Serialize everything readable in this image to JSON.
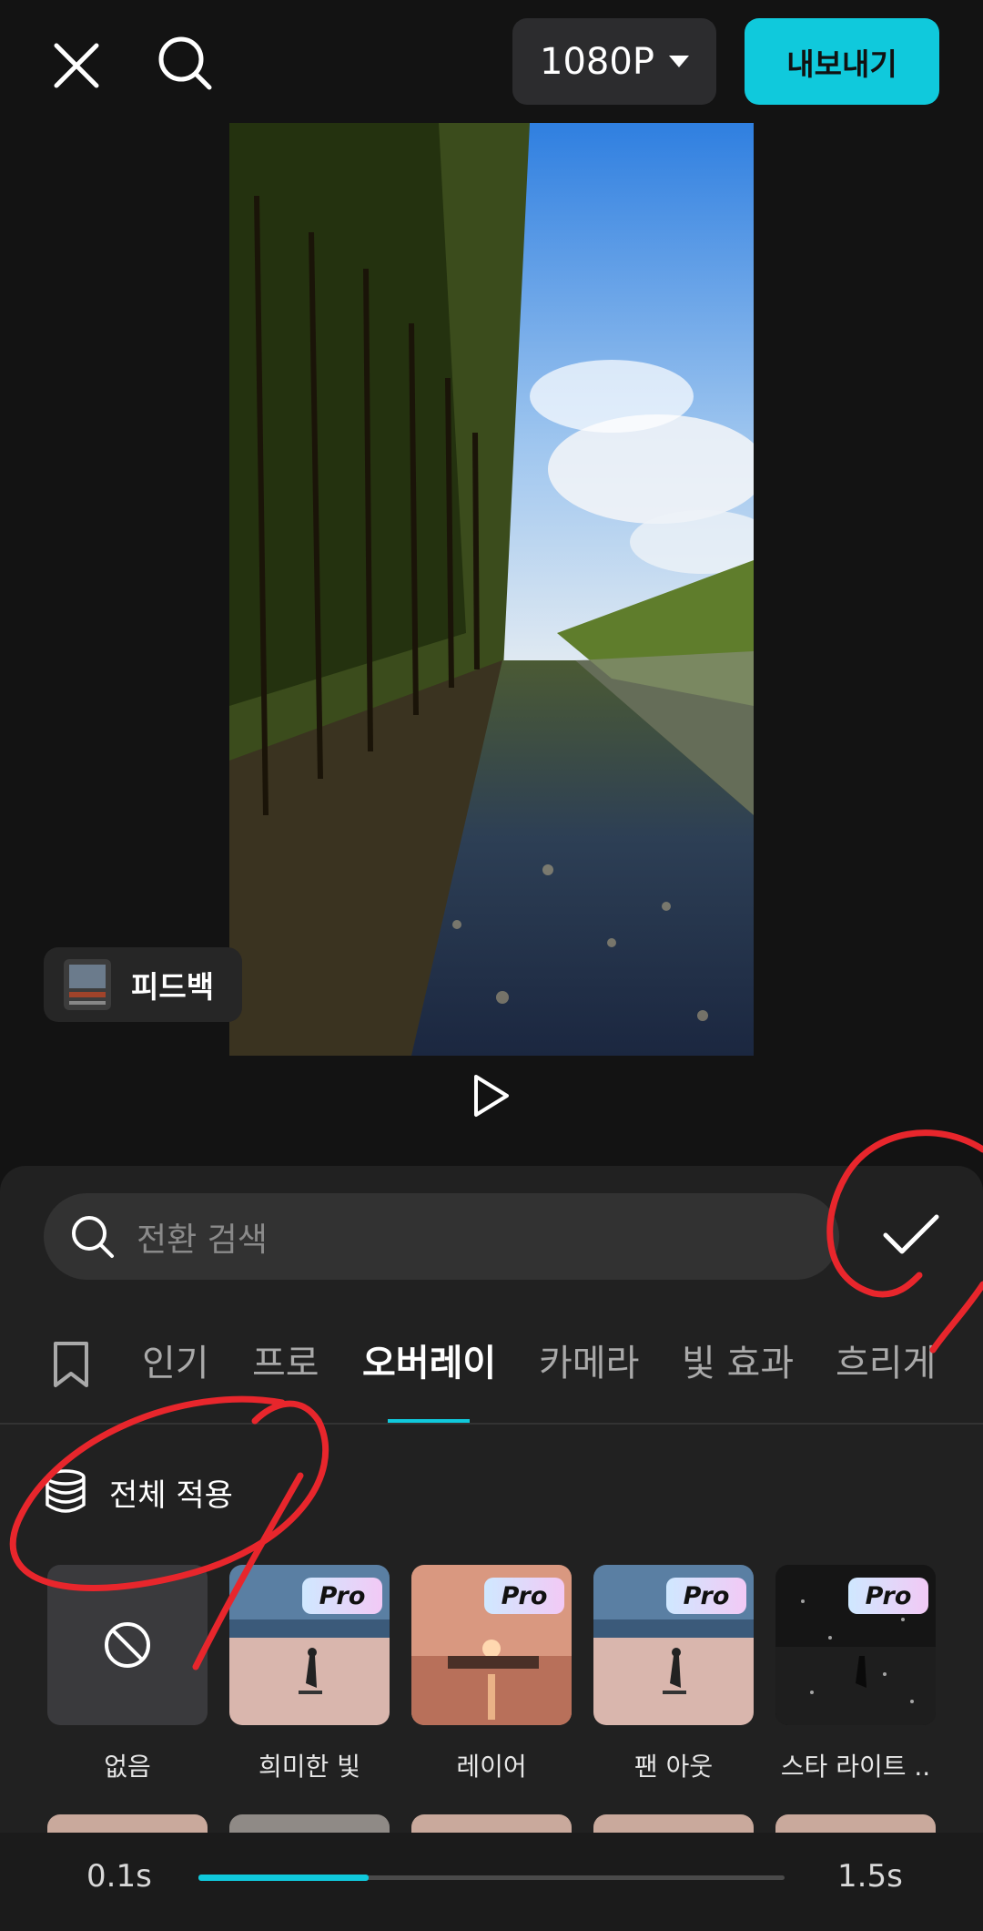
{
  "header": {
    "resolution_label": "1080P",
    "export_label": "내보내기"
  },
  "preview": {
    "feedback_label": "피드백"
  },
  "search": {
    "placeholder": "전환 검색"
  },
  "tabs": [
    {
      "label": "인기"
    },
    {
      "label": "프로"
    },
    {
      "label": "오버레이"
    },
    {
      "label": "카메라"
    },
    {
      "label": "빛 효과"
    },
    {
      "label": "흐리게"
    }
  ],
  "active_tab": "오버레이",
  "apply_all_label": "전체 적용",
  "transitions": [
    {
      "label": "없음",
      "pro": false
    },
    {
      "label": "희미한 빛",
      "pro": true,
      "badge": "Pro"
    },
    {
      "label": "레이어",
      "pro": true,
      "badge": "Pro"
    },
    {
      "label": "팬 아웃",
      "pro": true,
      "badge": "Pro"
    },
    {
      "label": "스타 라이트 ..",
      "pro": true,
      "badge": "Pro"
    }
  ],
  "duration": {
    "min_label": "0.1s",
    "max_label": "1.5s",
    "fraction": 0.29
  },
  "colors": {
    "accent": "#10c9dc",
    "annotation": "#e8262c"
  }
}
